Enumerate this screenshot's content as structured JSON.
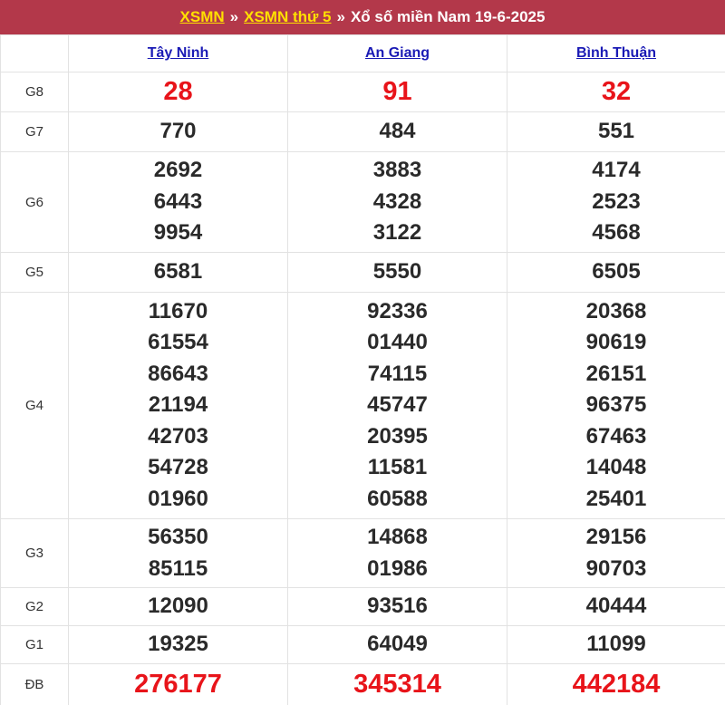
{
  "header": {
    "link1": "XSMN",
    "sep1": "»",
    "link2": "XSMN thứ 5",
    "sep2": "»",
    "title": "Xổ số miền Nam 19-6-2025"
  },
  "provinces": [
    "Tây Ninh",
    "An Giang",
    "Bình Thuận"
  ],
  "prizes": [
    {
      "label": "G8",
      "red": true,
      "values": [
        [
          "28"
        ],
        [
          "91"
        ],
        [
          "32"
        ]
      ]
    },
    {
      "label": "G7",
      "red": false,
      "values": [
        [
          "770"
        ],
        [
          "484"
        ],
        [
          "551"
        ]
      ]
    },
    {
      "label": "G6",
      "red": false,
      "values": [
        [
          "2692",
          "6443",
          "9954"
        ],
        [
          "3883",
          "4328",
          "3122"
        ],
        [
          "4174",
          "2523",
          "4568"
        ]
      ]
    },
    {
      "label": "G5",
      "red": false,
      "values": [
        [
          "6581"
        ],
        [
          "5550"
        ],
        [
          "6505"
        ]
      ]
    },
    {
      "label": "G4",
      "red": false,
      "values": [
        [
          "11670",
          "61554",
          "86643",
          "21194",
          "42703",
          "54728",
          "01960"
        ],
        [
          "92336",
          "01440",
          "74115",
          "45747",
          "20395",
          "11581",
          "60588"
        ],
        [
          "20368",
          "90619",
          "26151",
          "96375",
          "67463",
          "14048",
          "25401"
        ]
      ]
    },
    {
      "label": "G3",
      "red": false,
      "values": [
        [
          "56350",
          "85115"
        ],
        [
          "14868",
          "01986"
        ],
        [
          "29156",
          "90703"
        ]
      ]
    },
    {
      "label": "G2",
      "red": false,
      "values": [
        [
          "12090"
        ],
        [
          "93516"
        ],
        [
          "40444"
        ]
      ]
    },
    {
      "label": "G1",
      "red": false,
      "values": [
        [
          "19325"
        ],
        [
          "64049"
        ],
        [
          "11099"
        ]
      ]
    },
    {
      "label": "ĐB",
      "red": true,
      "values": [
        [
          "276177"
        ],
        [
          "345314"
        ],
        [
          "442184"
        ]
      ]
    }
  ],
  "colors": {
    "header_bg": "#b3384a",
    "header_link": "#ffe000",
    "province_link": "#1a1ab5",
    "highlight_number": "#e8141a"
  }
}
